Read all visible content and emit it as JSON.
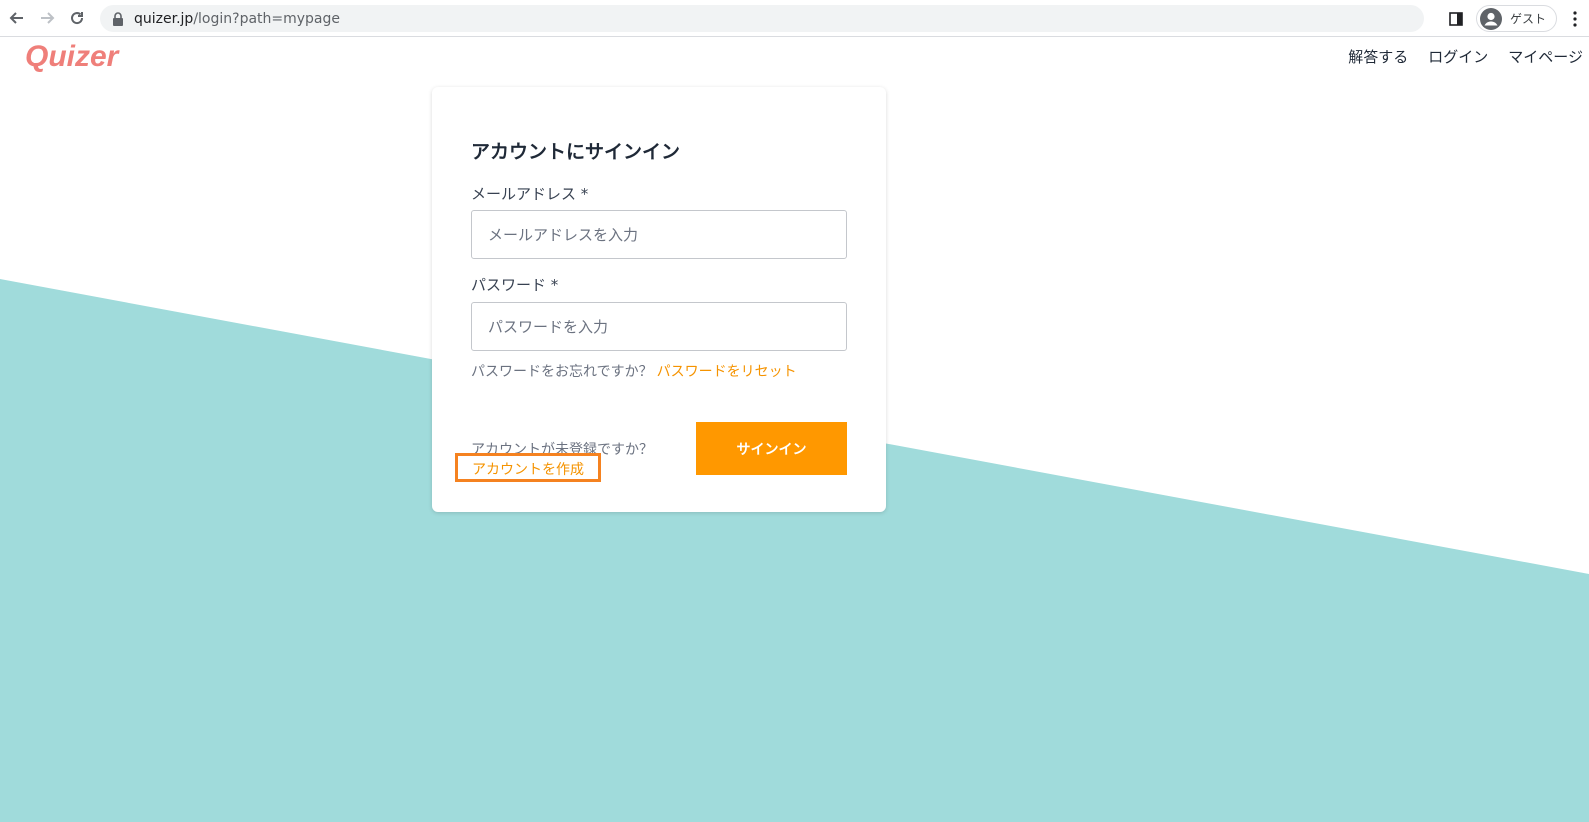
{
  "browser": {
    "url_host": "quizer.jp",
    "url_path": "/login?path=mypage",
    "profile_label": "ゲスト"
  },
  "header": {
    "logo": "Quizer",
    "nav": [
      "解答する",
      "ログイン",
      "マイページ"
    ]
  },
  "signin_card": {
    "title": "アカウントにサインイン",
    "email_label": "メールアドレス *",
    "email_placeholder": "メールアドレスを入力",
    "email_value": "",
    "password_label": "パスワード *",
    "password_placeholder": "パスワードを入力",
    "password_value": "",
    "forgot_text": "パスワードをお忘れですか？",
    "forgot_link": "パスワードをリセット",
    "no_account_text": "アカウントが未登録ですか？",
    "create_account_link": "アカウントを作成",
    "signin_button": "サインイン"
  },
  "colors": {
    "accent": "#ff9800",
    "link": "#f59300",
    "logo": "#ef7f7a",
    "background_band": "#a0dbdb",
    "highlight_box": "#f58220"
  }
}
